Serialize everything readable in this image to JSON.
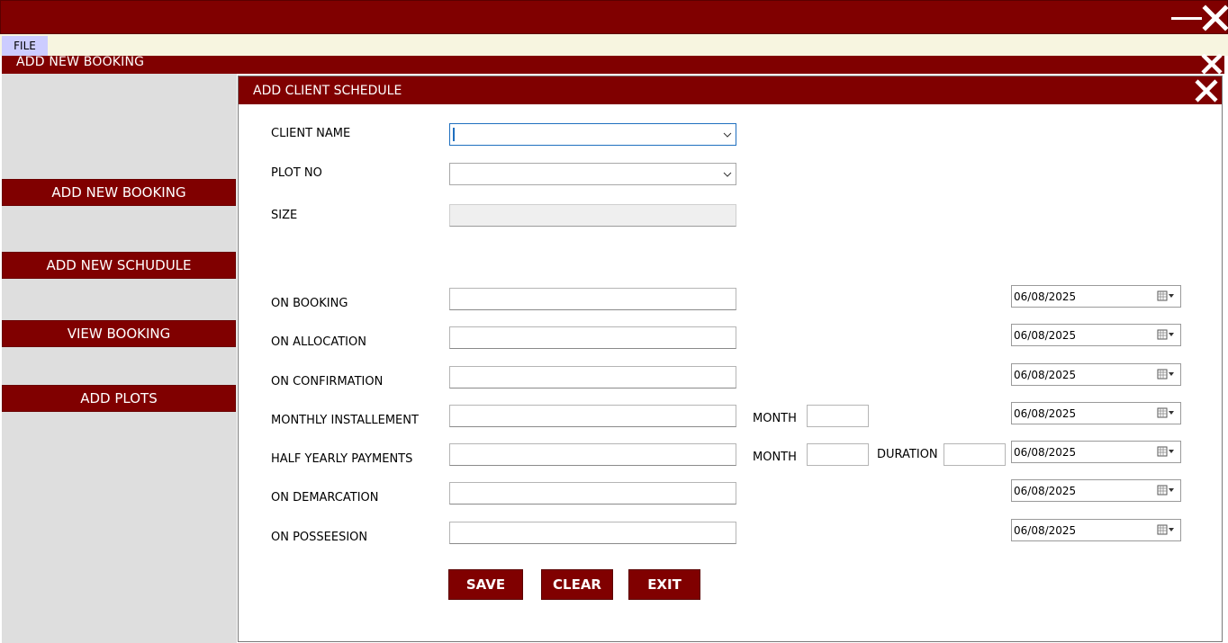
{
  "titlebar": {
    "minimize_icon": "minimize-icon",
    "close_icon": "close-icon"
  },
  "menubar": {
    "file_label": "FILE"
  },
  "booking_window": {
    "title": "ADD NEW BOOKING",
    "close_icon": "close-icon"
  },
  "sidebar": {
    "items": [
      {
        "label": "ADD NEW BOOKING"
      },
      {
        "label": "ADD NEW SCHUDULE"
      },
      {
        "label": "VIEW BOOKING"
      },
      {
        "label": "ADD PLOTS"
      }
    ]
  },
  "schedule_window": {
    "title": "ADD CLIENT SCHEDULE",
    "fields": {
      "client_name": {
        "label": "CLIENT NAME",
        "value": ""
      },
      "plot_no": {
        "label": "PLOT NO",
        "value": ""
      },
      "size": {
        "label": "SIZE",
        "value": ""
      }
    },
    "payments": [
      {
        "label": "ON BOOKING",
        "value": "",
        "date": "06/08/2025"
      },
      {
        "label": "ON ALLOCATION",
        "value": "",
        "date": "06/08/2025"
      },
      {
        "label": "ON CONFIRMATION",
        "value": "",
        "date": "06/08/2025"
      },
      {
        "label": "MONTHLY INSTALLEMENT",
        "value": "",
        "date": "06/08/2025",
        "month_label": "MONTH",
        "month_value": ""
      },
      {
        "label": "HALF YEARLY PAYMENTS",
        "value": "",
        "date": "06/08/2025",
        "month_label": "MONTH",
        "month_value": "",
        "duration_label": "DURATION",
        "duration_value": ""
      },
      {
        "label": "ON DEMARCATION",
        "value": "",
        "date": "06/08/2025"
      },
      {
        "label": "ON POSSEESION",
        "value": "",
        "date": "06/08/2025"
      }
    ],
    "buttons": {
      "save": "SAVE",
      "clear": "CLEAR",
      "exit": "EXIT"
    }
  },
  "colors": {
    "accent": "#800000",
    "menubar": "#f7f5e0",
    "file_highlight": "#ccccff",
    "sidebar_bg": "#dedede"
  }
}
